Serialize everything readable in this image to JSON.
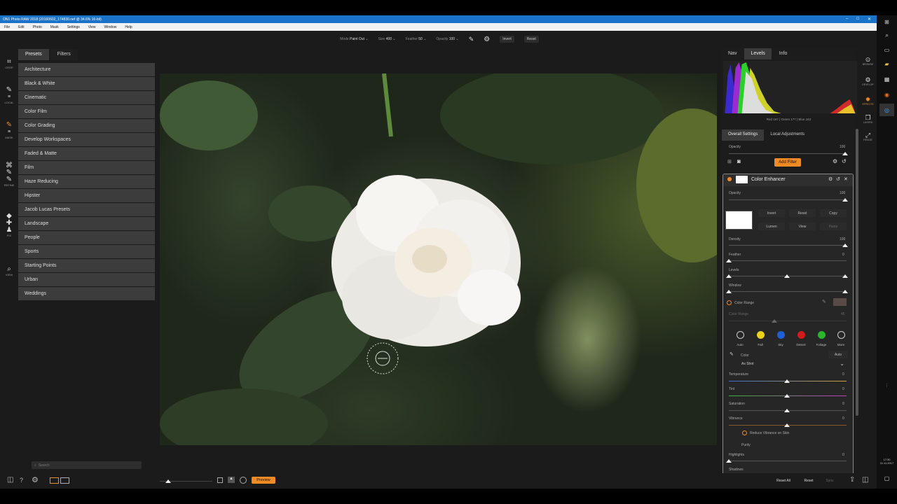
{
  "window": {
    "title": "ON1 Photo RAW 2018 (20160602_174830.nef @ 34.6% 16-bit)",
    "controls": [
      "–",
      "□",
      "✕"
    ]
  },
  "menu": [
    "File",
    "Edit",
    "Photo",
    "Mask",
    "Settings",
    "View",
    "Window",
    "Help"
  ],
  "toolbar": {
    "mode_label": "Mode",
    "mode_value": "Paint Out",
    "size_label": "Size",
    "size_value": "400",
    "feather_label": "Feather",
    "feather_value": "50",
    "opacity_label": "Opacity",
    "opacity_value": "100",
    "invert_label": "Invert",
    "reset_label": "Reset"
  },
  "leftnav": {
    "crop": "CROP",
    "local": "LOCAL",
    "mask": "MASK",
    "refine": "REFINE",
    "fix": "FIX",
    "view": "VIEW"
  },
  "presets": {
    "tab_presets": "Presets",
    "tab_filters": "Filters",
    "items": [
      "Architecture",
      "Black & White",
      "Cinematic",
      "Color Film",
      "Color Grading",
      "Develop Workspaces",
      "Faded & Matte",
      "Film",
      "Haze Reducing",
      "Hipster",
      "Jacob Lucas Presets",
      "Landscape",
      "People",
      "Sports",
      "Starting Points",
      "Urban",
      "Weddings"
    ],
    "search_placeholder": "Search"
  },
  "right": {
    "tabs": [
      "Nav",
      "Levels",
      "Info"
    ],
    "rgb": "Red 167 | Green 177 | Blue 163",
    "subtabs": [
      "Overall Settings",
      "Local Adjustments"
    ],
    "opacity_label": "Opacity",
    "opacity_value": "100",
    "add_filter": "Add Filter",
    "filter": {
      "name": "Color Enhancer",
      "opacity_label": "Opacity",
      "opacity_value": "100",
      "buttons": [
        "Invert",
        "Reset",
        "Copy",
        "Lumen",
        "View",
        "Paste"
      ],
      "density_label": "Density",
      "density_value": "100",
      "feather_label": "Feather",
      "feather_value": "0",
      "levels_label": "Levels",
      "window_label": "Window",
      "color_range_label": "Color Range",
      "color_range_sub": "Color Range",
      "color_range_value": "45",
      "presets": [
        {
          "label": "Auto",
          "color": "#cccccc"
        },
        {
          "label": "Fall",
          "color": "#e6d21f"
        },
        {
          "label": "Sky",
          "color": "#1e5fd8"
        },
        {
          "label": "Desert",
          "color": "#d21c1c"
        },
        {
          "label": "Foliage",
          "color": "#2bb52b"
        },
        {
          "label": "More",
          "color": "#cccccc"
        }
      ],
      "color_label": "Color",
      "auto_label": "Auto",
      "as_shot": "As Shot",
      "temperature_label": "Temperature",
      "temperature_value": "0",
      "tint_label": "Tint",
      "tint_value": "0",
      "saturation_label": "Saturation",
      "saturation_value": "0",
      "vibrance_label": "Vibrance",
      "vibrance_value": "0",
      "reduce_vibrance": "Reduce Vibrance on Skin",
      "purity_label": "Purity",
      "highlights_label": "Highlights",
      "highlights_value": "0",
      "shadows_label": "Shadows"
    }
  },
  "modules": [
    "BROWSE",
    "DEVELOP",
    "EFFECTS",
    "LAYERS",
    "RESIZE"
  ],
  "bottom": {
    "preview": "Preview",
    "reset_all": "Reset All",
    "reset": "Reset",
    "sync": "Sync"
  },
  "taskbar": {
    "time": "17:30",
    "date": "11.11.2017"
  },
  "colors": {
    "accent": "#f08a24",
    "titlebar": "#1a73c8"
  }
}
